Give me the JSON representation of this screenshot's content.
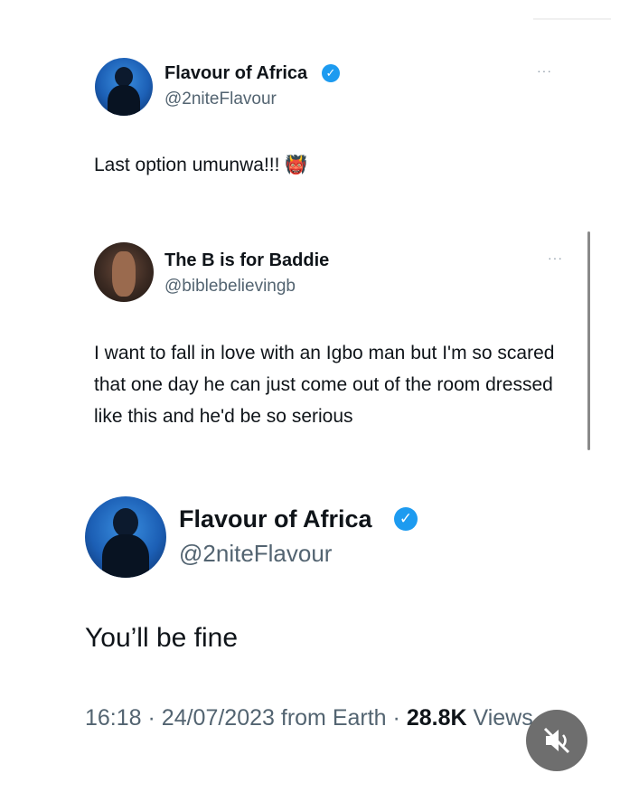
{
  "main_tweet": {
    "author_name": "Flavour of Africa",
    "author_handle": "@2niteFlavour",
    "text": "Last option umunwa!!!",
    "emoji": "👹",
    "more_label": "···"
  },
  "quoted_tweet": {
    "author_name": "The B is for Baddie",
    "author_handle": "@biblebelievingb",
    "text": "I want to fall in love with an Igbo man but I'm so scared that one day he can just come out of the room dressed like this and he'd be so serious",
    "more_label": "···"
  },
  "reply_tweet": {
    "author_name": "Flavour of Africa",
    "author_handle": "@2niteFlavour",
    "text": "You’ll be fine",
    "time": "16:18",
    "date": "24/07/2023",
    "source": "from Earth",
    "views_count": "28.8K",
    "views_label": "Views"
  },
  "colors": {
    "verified": "#1d9bf0",
    "handle": "#536471",
    "text": "#0f1419"
  },
  "icons": {
    "verified": "verified-badge-icon",
    "more": "more-options-icon",
    "mute": "mute-speaker-icon"
  }
}
